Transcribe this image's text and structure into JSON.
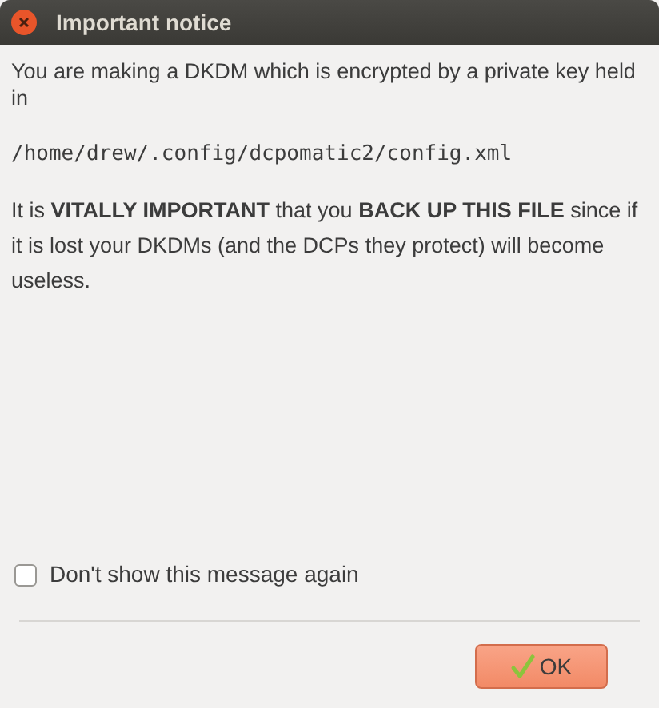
{
  "window": {
    "title": "Important notice"
  },
  "message": {
    "intro": "You are making a DKDM which is encrypted by a private key held in",
    "path": "/home/drew/.config/dcpomatic2/config.xml",
    "warning": "It is **VITALLY IMPORTANT** that you **BACK UP THIS FILE** since if it is lost your DKDMs (and the DCPs they protect) will become useless."
  },
  "dont_show_again": {
    "label": "Don't show this message again",
    "checked": false
  },
  "buttons": [
    {
      "label": "OK",
      "kind": "ok"
    }
  ]
}
